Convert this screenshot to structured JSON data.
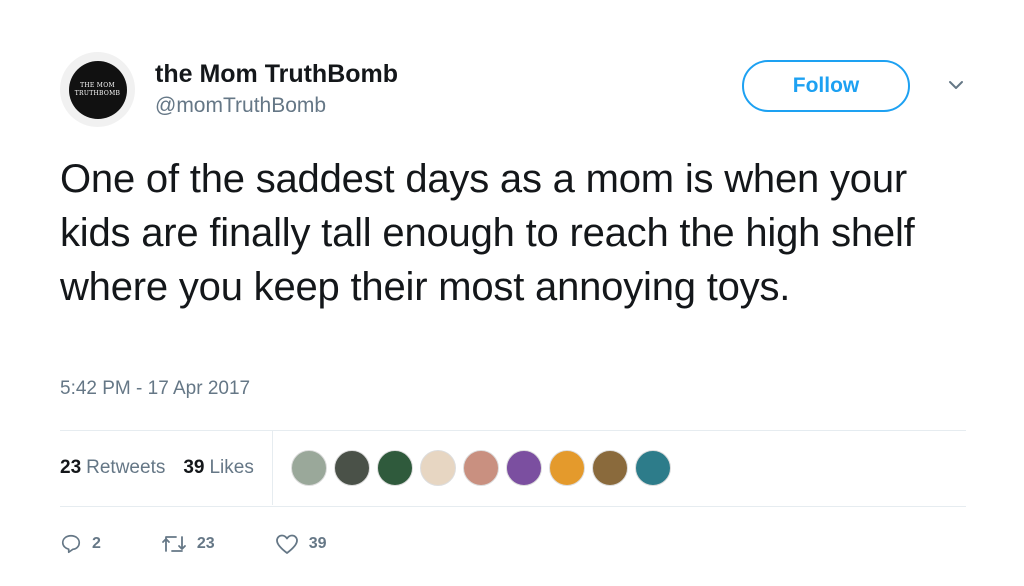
{
  "author": {
    "display_name": "the Mom TruthBomb",
    "handle": "@momTruthBomb",
    "avatar_text": "THE MOM TRUTHBOMB"
  },
  "follow_button": {
    "label": "Follow"
  },
  "tweet": {
    "text": "One of the saddest days as a mom is when your kids are finally tall enough to reach the high shelf where you keep their most annoying toys.",
    "timestamp": "5:42 PM - 17 Apr 2017"
  },
  "stats": {
    "retweets_count": "23",
    "retweets_label": "Retweets",
    "likes_count": "39",
    "likes_label": "Likes"
  },
  "likers": [
    {
      "name": "liker-1",
      "color": "#9aa89a"
    },
    {
      "name": "liker-2",
      "color": "#4a5148"
    },
    {
      "name": "liker-3",
      "color": "#2f5a3c"
    },
    {
      "name": "liker-4",
      "color": "#e7d6c2"
    },
    {
      "name": "liker-5",
      "color": "#c99080"
    },
    {
      "name": "liker-6",
      "color": "#7b4fa0"
    },
    {
      "name": "liker-7",
      "color": "#e49a2c"
    },
    {
      "name": "liker-8",
      "color": "#8a6a3c"
    },
    {
      "name": "liker-9",
      "color": "#2d7c8a"
    }
  ],
  "actions": {
    "reply_count": "2",
    "retweet_count": "23",
    "like_count": "39"
  },
  "colors": {
    "accent": "#1da1f2",
    "text": "#14171a",
    "secondary": "#657786",
    "divider": "#e6ecf0"
  }
}
